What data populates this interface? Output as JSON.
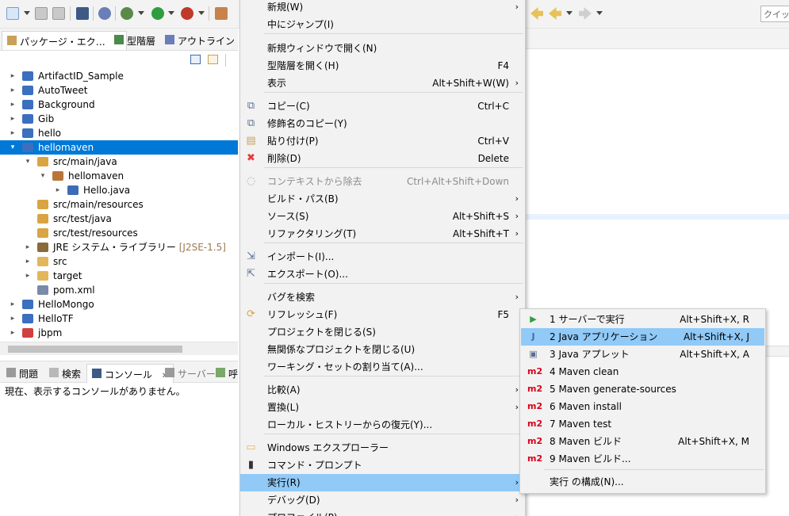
{
  "colors": {
    "selection": "#0078d7",
    "menu_hover": "#91c9f7",
    "menu_bg": "#f2f2f2",
    "maven_red": "#d9001b",
    "delete_red": "#e23b3b"
  },
  "toolbar": {
    "quick_access_placeholder": "クイック",
    "icons": [
      "new-icon",
      "save-icon",
      "save-all-icon",
      "console-icon",
      "settings-icon",
      "debug-icon",
      "run-icon",
      "external-tools-icon",
      "new-java-package-icon",
      "back-icon",
      "forward-icon"
    ]
  },
  "explorer": {
    "tabs": [
      {
        "label": "パッケージ・エク…",
        "icon": "package-explorer-icon",
        "close": "✕"
      },
      {
        "label": "型階層",
        "icon": "type-hierarchy-icon"
      },
      {
        "label": "アウトライン",
        "icon": "outline-icon"
      }
    ],
    "tree": [
      {
        "label": "ArtifactID_Sample",
        "icon": "maven-project-icon"
      },
      {
        "label": "AutoTweet",
        "icon": "java-project-icon"
      },
      {
        "label": "Background",
        "icon": "java-project-icon"
      },
      {
        "label": "Gib",
        "icon": "java-project-icon"
      },
      {
        "label": "hello",
        "icon": "maven-project-icon"
      },
      {
        "label": "hellomaven",
        "icon": "maven-project-icon"
      },
      {
        "label": "src/main/java",
        "icon": "source-folder-icon"
      },
      {
        "label": "hellomaven",
        "icon": "package-icon"
      },
      {
        "label": "Hello.java",
        "icon": "java-file-icon"
      },
      {
        "label": "src/main/resources",
        "icon": "source-folder-icon"
      },
      {
        "label": "src/test/java",
        "icon": "source-folder-icon"
      },
      {
        "label": "src/test/resources",
        "icon": "source-folder-icon"
      },
      {
        "label": "JRE システム・ライブラリー",
        "decoration": "[J2SE-1.5]",
        "icon": "library-icon"
      },
      {
        "label": "src",
        "icon": "folder-icon"
      },
      {
        "label": "target",
        "icon": "folder-icon"
      },
      {
        "label": "pom.xml",
        "icon": "xml-file-icon"
      },
      {
        "label": "HelloMongo",
        "icon": "maven-project-icon"
      },
      {
        "label": "HelloTF",
        "icon": "java-project-icon"
      },
      {
        "label": "jbpm",
        "icon": "java-project-error-icon"
      }
    ]
  },
  "console": {
    "tabs": [
      {
        "label": "問題",
        "icon": "problems-icon"
      },
      {
        "label": "検索",
        "icon": "search-icon"
      },
      {
        "label": "コンソール",
        "icon": "console-icon",
        "close": "✕"
      },
      {
        "label": "サーバー",
        "icon": "servers-icon"
      },
      {
        "label": "呼",
        "icon": "call-hierarchy-icon"
      }
    ],
    "message": "現在、表示するコンソールがありません。"
  },
  "context_menu": {
    "items": [
      {
        "label": "新規(W)",
        "accel": "",
        "submenu": true
      },
      {
        "label": "中にジャンプ(I)",
        "accel": ""
      },
      {
        "label": "新規ウィンドウで開く(N)",
        "accel": ""
      },
      {
        "label": "型階層を開く(H)",
        "accel": "F4"
      },
      {
        "label": "表示",
        "accel": "Alt+Shift+W(W)",
        "submenu": true
      },
      {
        "label": "コピー(C)",
        "accel": "Ctrl+C",
        "icon": "copy-icon"
      },
      {
        "label": "修飾名のコピー(Y)",
        "accel": "",
        "icon": "copy-qualified-name-icon"
      },
      {
        "label": "貼り付け(P)",
        "accel": "Ctrl+V",
        "icon": "paste-icon"
      },
      {
        "label": "削除(D)",
        "accel": "Delete",
        "icon": "delete-icon"
      },
      {
        "label": "コンテキストから除去",
        "accel": "Ctrl+Alt+Shift+Down",
        "icon": "remove-context-icon",
        "disabled": true
      },
      {
        "label": "ビルド・パス(B)",
        "accel": "",
        "submenu": true
      },
      {
        "label": "ソース(S)",
        "accel": "Alt+Shift+S",
        "submenu": true
      },
      {
        "label": "リファクタリング(T)",
        "accel": "Alt+Shift+T",
        "submenu": true
      },
      {
        "label": "インポート(I)...",
        "accel": "",
        "icon": "import-icon"
      },
      {
        "label": "エクスポート(O)...",
        "accel": "",
        "icon": "export-icon"
      },
      {
        "label": "バグを検索",
        "accel": "",
        "submenu": true
      },
      {
        "label": "リフレッシュ(F)",
        "accel": "F5",
        "icon": "refresh-icon"
      },
      {
        "label": "プロジェクトを閉じる(S)",
        "accel": ""
      },
      {
        "label": "無関係なプロジェクトを閉じる(U)",
        "accel": ""
      },
      {
        "label": "ワーキング・セットの割り当て(A)...",
        "accel": ""
      },
      {
        "label": "比較(A)",
        "accel": "",
        "submenu": true
      },
      {
        "label": "置換(L)",
        "accel": "",
        "submenu": true
      },
      {
        "label": "ローカル・ヒストリーからの復元(Y)...",
        "accel": ""
      },
      {
        "label": "Windows エクスプローラー",
        "accel": "",
        "icon": "windows-explorer-icon"
      },
      {
        "label": "コマンド・プロンプト",
        "accel": "",
        "icon": "command-prompt-icon"
      },
      {
        "label": "実行(R)",
        "accel": "",
        "submenu": true,
        "hover": true
      },
      {
        "label": "デバッグ(D)",
        "accel": "",
        "submenu": true
      },
      {
        "label": "プロファイル(P)",
        "accel": "",
        "submenu": true
      }
    ]
  },
  "run_submenu": {
    "items": [
      {
        "label": "1 サーバーで実行",
        "accel": "Alt+Shift+X, R",
        "icon": "run-on-server-icon"
      },
      {
        "label": "2 Java アプリケーション",
        "accel": "Alt+Shift+X, J",
        "icon": "java-application-icon",
        "hover": true
      },
      {
        "label": "3 Java アプレット",
        "accel": "Alt+Shift+X, A",
        "icon": "java-applet-icon"
      },
      {
        "label": "4 Maven clean",
        "accel": "",
        "icon": "maven-icon"
      },
      {
        "label": "5 Maven generate-sources",
        "accel": "",
        "icon": "maven-icon"
      },
      {
        "label": "6 Maven install",
        "accel": "",
        "icon": "maven-icon"
      },
      {
        "label": "7 Maven test",
        "accel": "",
        "icon": "maven-icon"
      },
      {
        "label": "8 Maven ビルド",
        "accel": "Alt+Shift+X, M",
        "icon": "maven-icon"
      },
      {
        "label": "9 Maven ビルド...",
        "accel": "",
        "icon": "maven-icon"
      },
      {
        "label": "実行 の構成(N)...",
        "accel": ""
      }
    ],
    "maven_icon_text": "m2"
  }
}
